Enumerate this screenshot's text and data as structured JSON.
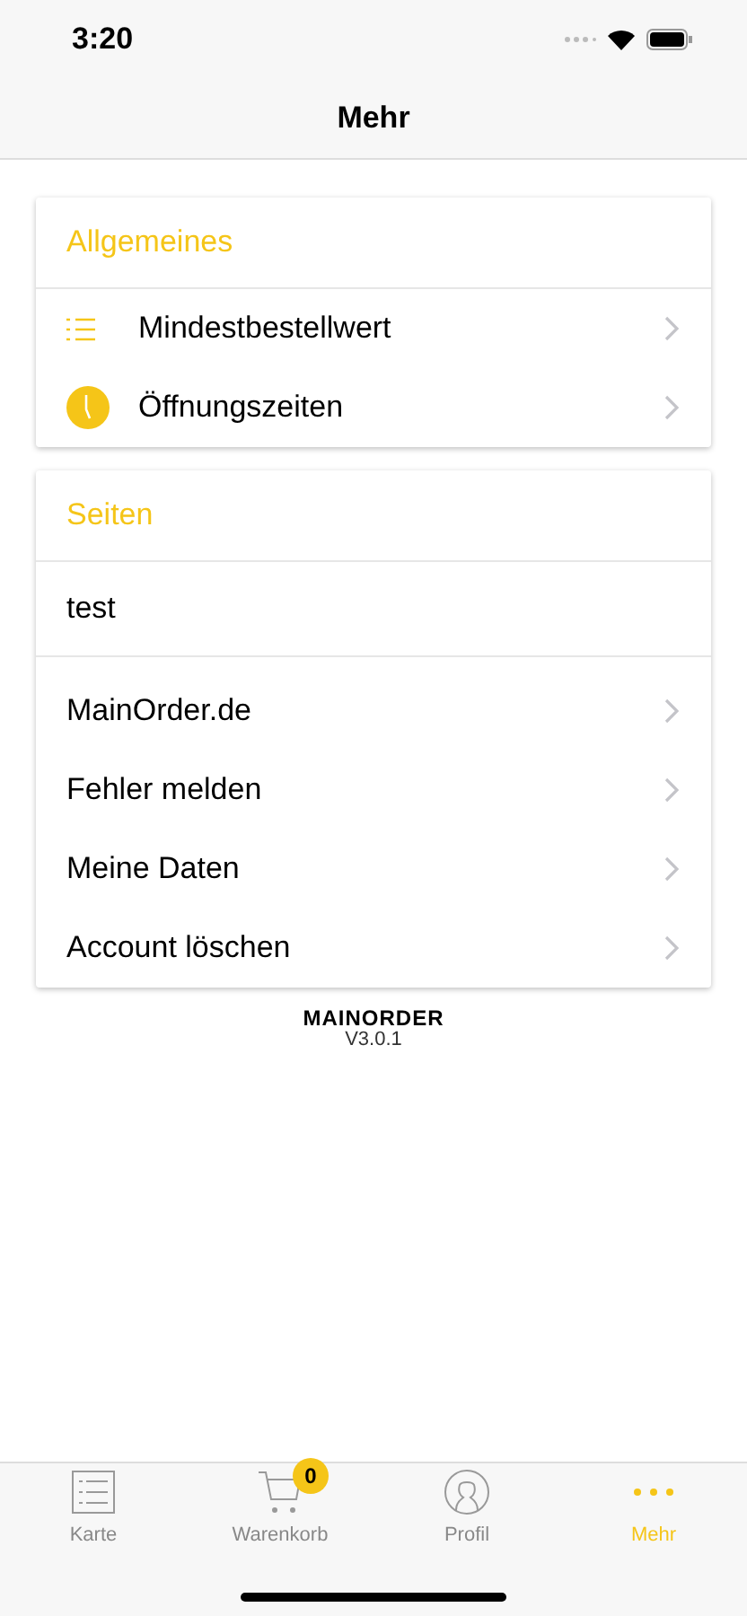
{
  "status_bar": {
    "time": "3:20"
  },
  "nav": {
    "title": "Mehr"
  },
  "sections": [
    {
      "title": "Allgemeines",
      "items": [
        {
          "kind": "link",
          "label": "Mindestbestellwert"
        },
        {
          "kind": "link",
          "label": "Öffnungszeiten"
        }
      ]
    },
    {
      "title": "Seiten",
      "items": [
        {
          "kind": "plain",
          "label": "test"
        },
        {
          "kind": "link",
          "label": "MainOrder.de"
        },
        {
          "kind": "link",
          "label": "Fehler melden"
        },
        {
          "kind": "link",
          "label": "Meine Daten"
        },
        {
          "kind": "link",
          "label": "Account löschen"
        }
      ]
    }
  ],
  "footer": {
    "brand": "MAINORDER",
    "version": "V3.0.1"
  },
  "tabs": [
    {
      "label": "Karte",
      "selected": false
    },
    {
      "label": "Warenkorb",
      "selected": false,
      "badge": "0"
    },
    {
      "label": "Profil",
      "selected": false
    },
    {
      "label": "Mehr",
      "selected": true
    }
  ]
}
